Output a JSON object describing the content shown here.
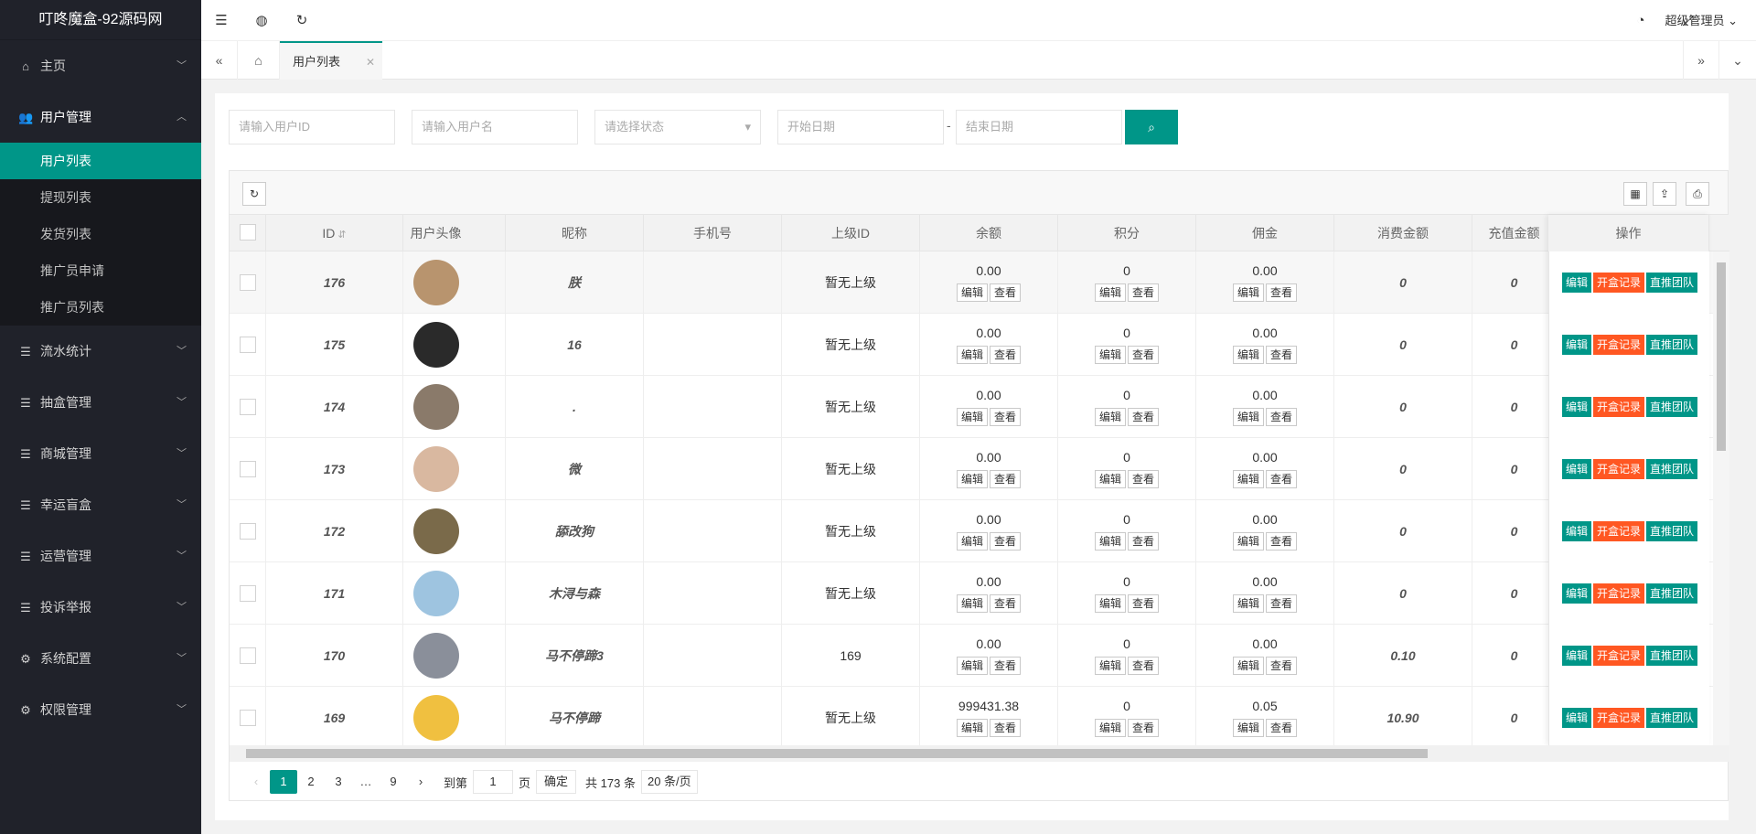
{
  "app": {
    "title": "叮咚魔盒-92源码网"
  },
  "sidebar": {
    "items": [
      {
        "label": "主页",
        "icon": "home-icon",
        "open": false
      },
      {
        "label": "用户管理",
        "icon": "users-icon",
        "open": true
      },
      {
        "label": "流水统计",
        "icon": "list-icon",
        "open": false
      },
      {
        "label": "抽盒管理",
        "icon": "list-icon",
        "open": false
      },
      {
        "label": "商城管理",
        "icon": "list-icon",
        "open": false
      },
      {
        "label": "幸运盲盒",
        "icon": "list-icon",
        "open": false
      },
      {
        "label": "运营管理",
        "icon": "list-icon",
        "open": false
      },
      {
        "label": "投诉举报",
        "icon": "list-icon",
        "open": false
      },
      {
        "label": "系统配置",
        "icon": "settings-icon",
        "open": false
      },
      {
        "label": "权限管理",
        "icon": "gear-icon",
        "open": false
      }
    ],
    "sub": [
      "用户列表",
      "提现列表",
      "发货列表",
      "推广员申请",
      "推广员列表"
    ]
  },
  "topbar": {
    "user": "超级管理员"
  },
  "tabs": {
    "active": "用户列表"
  },
  "filters": {
    "uid_placeholder": "请输入用户ID",
    "name_placeholder": "请输入用户名",
    "status_placeholder": "请选择状态",
    "start_placeholder": "开始日期",
    "end_placeholder": "结束日期",
    "dash": "-"
  },
  "table": {
    "headers": [
      "ID",
      "用户头像",
      "昵称",
      "手机号",
      "上级ID",
      "余额",
      "积分",
      "佣金",
      "消费金额",
      "充值金额",
      "操作"
    ],
    "edit": "编辑",
    "view": "查看",
    "ops": [
      "编辑",
      "开盒记录",
      "直推团队"
    ],
    "rows": [
      {
        "id": "176",
        "nick": "朕",
        "phone": "",
        "parent": "暂无上级",
        "balance": "0.00",
        "points": "0",
        "commission": "0.00",
        "spend": "0",
        "recharge": "0",
        "av": "#b8946e"
      },
      {
        "id": "175",
        "nick": "16",
        "phone": "",
        "parent": "暂无上级",
        "balance": "0.00",
        "points": "0",
        "commission": "0.00",
        "spend": "0",
        "recharge": "0",
        "av": "#2a2a2a"
      },
      {
        "id": "174",
        "nick": ".",
        "phone": "",
        "parent": "暂无上级",
        "balance": "0.00",
        "points": "0",
        "commission": "0.00",
        "spend": "0",
        "recharge": "0",
        "av": "#8a7a6a"
      },
      {
        "id": "173",
        "nick": "微",
        "phone": "",
        "parent": "暂无上级",
        "balance": "0.00",
        "points": "0",
        "commission": "0.00",
        "spend": "0",
        "recharge": "0",
        "av": "#d9b8a0"
      },
      {
        "id": "172",
        "nick": "舔改狗",
        "phone": "",
        "parent": "暂无上级",
        "balance": "0.00",
        "points": "0",
        "commission": "0.00",
        "spend": "0",
        "recharge": "0",
        "av": "#7a6a4a"
      },
      {
        "id": "171",
        "nick": "木浔与森",
        "phone": "",
        "parent": "暂无上级",
        "balance": "0.00",
        "points": "0",
        "commission": "0.00",
        "spend": "0",
        "recharge": "0",
        "av": "#9ec4e0"
      },
      {
        "id": "170",
        "nick": "马不停蹄3",
        "phone": "",
        "parent": "169",
        "balance": "0.00",
        "points": "0",
        "commission": "0.00",
        "spend": "0.10",
        "recharge": "0",
        "av": "#8a8f9a"
      },
      {
        "id": "169",
        "nick": "马不停蹄",
        "phone": "",
        "parent": "暂无上级",
        "balance": "999431.38",
        "points": "0",
        "commission": "0.05",
        "spend": "10.90",
        "recharge": "0",
        "av": "#f0c040"
      }
    ]
  },
  "pager": {
    "pages": [
      "1",
      "2",
      "3",
      "…",
      "9"
    ],
    "goto": "到第",
    "page_value": "1",
    "page_unit": "页",
    "confirm": "确定",
    "total": "共 173 条",
    "size": "20 条/页"
  }
}
